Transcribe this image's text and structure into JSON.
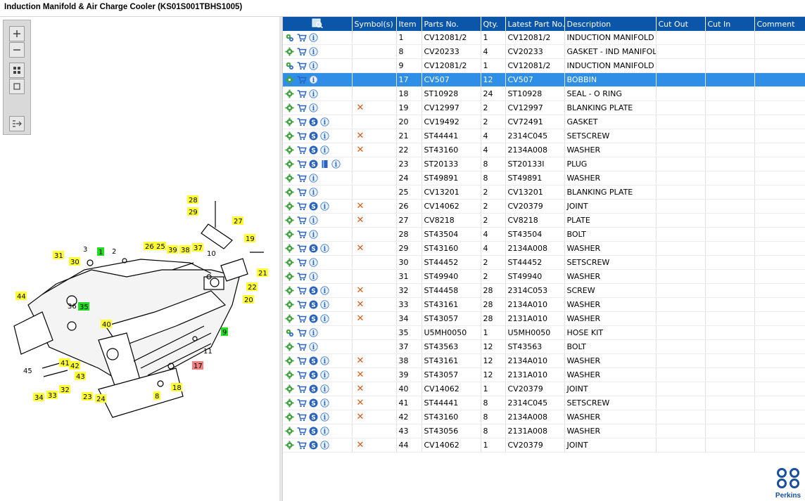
{
  "window": {
    "title": "Induction Manifold & Air Charge Cooler (KS01S001TBHS1005)"
  },
  "toolbar": {
    "buttons": [
      "zoom-in-icon",
      "zoom-out-icon",
      "fit-view-icon",
      "actual-size-icon",
      "expand-panel-icon"
    ]
  },
  "table": {
    "columns": [
      "",
      "Symbol(s)",
      "Item",
      "Parts No.",
      "Qty.",
      "Latest Part No.",
      "Description",
      "Cut Out",
      "Cut In",
      "Comment"
    ],
    "rows": [
      {
        "icons": "gears-cart-info",
        "sym": "",
        "item": "1",
        "part": "CV12081/2",
        "qty": "1",
        "latest": "CV12081/2",
        "desc": "INDUCTION MANIFOLD"
      },
      {
        "icons": "gear-cart-info",
        "sym": "",
        "item": "8",
        "part": "CV20233",
        "qty": "4",
        "latest": "CV20233",
        "desc": "GASKET - IND MANIFOLD"
      },
      {
        "icons": "gears-cart-info",
        "sym": "",
        "item": "9",
        "part": "CV12081/2",
        "qty": "1",
        "latest": "CV12081/2",
        "desc": "INDUCTION MANIFOLD"
      },
      {
        "icons": "gear-cart-info",
        "sym": "",
        "item": "17",
        "part": "CV507",
        "qty": "12",
        "latest": "CV507",
        "desc": "BOBBIN",
        "selected": true
      },
      {
        "icons": "gear-cart-info",
        "sym": "",
        "item": "18",
        "part": "ST10928",
        "qty": "24",
        "latest": "ST10928",
        "desc": "SEAL - O RING"
      },
      {
        "icons": "gear-cart-info",
        "sym": "x",
        "item": "19",
        "part": "CV12997",
        "qty": "2",
        "latest": "CV12997",
        "desc": "BLANKING PLATE"
      },
      {
        "icons": "gear-cart-s-info",
        "sym": "",
        "item": "20",
        "part": "CV19492",
        "qty": "2",
        "latest": "CV72491",
        "desc": "GASKET"
      },
      {
        "icons": "gear-cart-s-info",
        "sym": "x",
        "item": "21",
        "part": "ST44441",
        "qty": "4",
        "latest": "2314C045",
        "desc": "SETSCREW"
      },
      {
        "icons": "gear-cart-s-info",
        "sym": "x",
        "item": "22",
        "part": "ST43160",
        "qty": "4",
        "latest": "2134A008",
        "desc": "WASHER"
      },
      {
        "icons": "gear-cart-s-book-info",
        "sym": "",
        "item": "23",
        "part": "ST20133",
        "qty": "8",
        "latest": "ST20133I",
        "desc": "PLUG"
      },
      {
        "icons": "gear-cart-info",
        "sym": "",
        "item": "24",
        "part": "ST49891",
        "qty": "8",
        "latest": "ST49891",
        "desc": "WASHER"
      },
      {
        "icons": "gear-cart-info",
        "sym": "",
        "item": "25",
        "part": "CV13201",
        "qty": "2",
        "latest": "CV13201",
        "desc": "BLANKING PLATE"
      },
      {
        "icons": "gear-cart-s-info",
        "sym": "x",
        "item": "26",
        "part": "CV14062",
        "qty": "2",
        "latest": "CV20379",
        "desc": "JOINT"
      },
      {
        "icons": "gear-cart-info",
        "sym": "x",
        "item": "27",
        "part": "CV8218",
        "qty": "2",
        "latest": "CV8218",
        "desc": "PLATE"
      },
      {
        "icons": "gear-cart-info",
        "sym": "",
        "item": "28",
        "part": "ST43504",
        "qty": "4",
        "latest": "ST43504",
        "desc": "BOLT"
      },
      {
        "icons": "gear-cart-s-info",
        "sym": "x",
        "item": "29",
        "part": "ST43160",
        "qty": "4",
        "latest": "2134A008",
        "desc": "WASHER"
      },
      {
        "icons": "gear-cart-info",
        "sym": "",
        "item": "30",
        "part": "ST44452",
        "qty": "2",
        "latest": "ST44452",
        "desc": "SETSCREW"
      },
      {
        "icons": "gear-cart-info",
        "sym": "",
        "item": "31",
        "part": "ST49940",
        "qty": "2",
        "latest": "ST49940",
        "desc": "WASHER"
      },
      {
        "icons": "gear-cart-s-info",
        "sym": "x",
        "item": "32",
        "part": "ST44458",
        "qty": "28",
        "latest": "2314C053",
        "desc": "SCREW"
      },
      {
        "icons": "gear-cart-s-info",
        "sym": "x",
        "item": "33",
        "part": "ST43161",
        "qty": "28",
        "latest": "2134A010",
        "desc": "WASHER"
      },
      {
        "icons": "gear-cart-s-info",
        "sym": "x",
        "item": "34",
        "part": "ST43057",
        "qty": "28",
        "latest": "2131A010",
        "desc": "WASHER"
      },
      {
        "icons": "gears-cart-info",
        "sym": "",
        "item": "35",
        "part": "U5MH0050",
        "qty": "1",
        "latest": "U5MH0050",
        "desc": "HOSE KIT"
      },
      {
        "icons": "gear-cart-info",
        "sym": "",
        "item": "37",
        "part": "ST43563",
        "qty": "12",
        "latest": "ST43563",
        "desc": "BOLT"
      },
      {
        "icons": "gear-cart-s-info",
        "sym": "x",
        "item": "38",
        "part": "ST43161",
        "qty": "12",
        "latest": "2134A010",
        "desc": "WASHER"
      },
      {
        "icons": "gear-cart-s-info",
        "sym": "x",
        "item": "39",
        "part": "ST43057",
        "qty": "12",
        "latest": "2131A010",
        "desc": "WASHER"
      },
      {
        "icons": "gear-cart-s-info",
        "sym": "x",
        "item": "40",
        "part": "CV14062",
        "qty": "1",
        "latest": "CV20379",
        "desc": "JOINT"
      },
      {
        "icons": "gear-cart-s-info",
        "sym": "x",
        "item": "41",
        "part": "ST44441",
        "qty": "8",
        "latest": "2314C045",
        "desc": "SETSCREW"
      },
      {
        "icons": "gear-cart-s-info",
        "sym": "x",
        "item": "42",
        "part": "ST43160",
        "qty": "8",
        "latest": "2134A008",
        "desc": "WASHER"
      },
      {
        "icons": "gear-cart-s-info",
        "sym": "",
        "item": "43",
        "part": "ST43056",
        "qty": "8",
        "latest": "2131A008",
        "desc": "WASHER"
      },
      {
        "icons": "gear-cart-s-info",
        "sym": "x",
        "item": "44",
        "part": "CV14062",
        "qty": "1",
        "latest": "CV20379",
        "desc": "JOINT"
      }
    ]
  },
  "diagram": {
    "callouts": [
      {
        "n": "28",
        "c": "y"
      },
      {
        "n": "29",
        "c": "y"
      },
      {
        "n": "27",
        "c": "y"
      },
      {
        "n": "19",
        "c": "y"
      },
      {
        "n": "31",
        "c": "y"
      },
      {
        "n": "30",
        "c": "y"
      },
      {
        "n": "3",
        "c": "n"
      },
      {
        "n": "1",
        "c": "g"
      },
      {
        "n": "2",
        "c": "n"
      },
      {
        "n": "26",
        "c": "y"
      },
      {
        "n": "25",
        "c": "y"
      },
      {
        "n": "39",
        "c": "y"
      },
      {
        "n": "38",
        "c": "y"
      },
      {
        "n": "37",
        "c": "y"
      },
      {
        "n": "10",
        "c": "n"
      },
      {
        "n": "21",
        "c": "y"
      },
      {
        "n": "22",
        "c": "y"
      },
      {
        "n": "20",
        "c": "y"
      },
      {
        "n": "44",
        "c": "y"
      },
      {
        "n": "36",
        "c": "n"
      },
      {
        "n": "35",
        "c": "g"
      },
      {
        "n": "40",
        "c": "y"
      },
      {
        "n": "9",
        "c": "g"
      },
      {
        "n": "11",
        "c": "n"
      },
      {
        "n": "45",
        "c": "n"
      },
      {
        "n": "41",
        "c": "y"
      },
      {
        "n": "42",
        "c": "y"
      },
      {
        "n": "43",
        "c": "y"
      },
      {
        "n": "17",
        "c": "r"
      },
      {
        "n": "18",
        "c": "y"
      },
      {
        "n": "34",
        "c": "y"
      },
      {
        "n": "33",
        "c": "y"
      },
      {
        "n": "32",
        "c": "y"
      },
      {
        "n": "23",
        "c": "y"
      },
      {
        "n": "24",
        "c": "y"
      },
      {
        "n": "8",
        "c": "y"
      }
    ]
  },
  "logo": {
    "text": "Perkins"
  },
  "colors": {
    "header": "#0b56a8",
    "selected": "#2f8fe6",
    "callout_yellow": "#ffff33",
    "callout_green": "#22dd22",
    "callout_red": "#f08080",
    "cross": "#e05a18"
  }
}
